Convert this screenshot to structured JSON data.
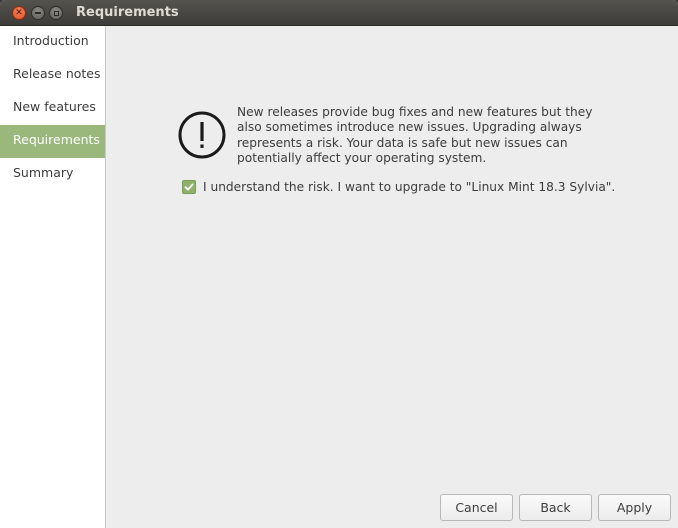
{
  "window": {
    "title": "Requirements"
  },
  "sidebar": {
    "items": [
      {
        "label": "Introduction",
        "active": false
      },
      {
        "label": "Release notes",
        "active": false
      },
      {
        "label": "New features",
        "active": false
      },
      {
        "label": "Requirements",
        "active": true
      },
      {
        "label": "Summary",
        "active": false
      }
    ]
  },
  "main": {
    "icon": "warning-exclamation-icon",
    "message": "New releases provide bug fixes and new features but they also sometimes introduce new issues. Upgrading always represents a risk. Your data is safe but new issues can potentially affect your operating system.",
    "checkbox": {
      "checked": true,
      "label": "I understand the risk. I want to upgrade to \"Linux Mint 18.3 Sylvia\"."
    }
  },
  "buttons": {
    "cancel": "Cancel",
    "back": "Back",
    "apply": "Apply"
  },
  "colors": {
    "accent": "#9ab87c",
    "checkbox": "#8fb26a",
    "close_button": "#e0502a",
    "titlebar": "#3d3c38"
  }
}
